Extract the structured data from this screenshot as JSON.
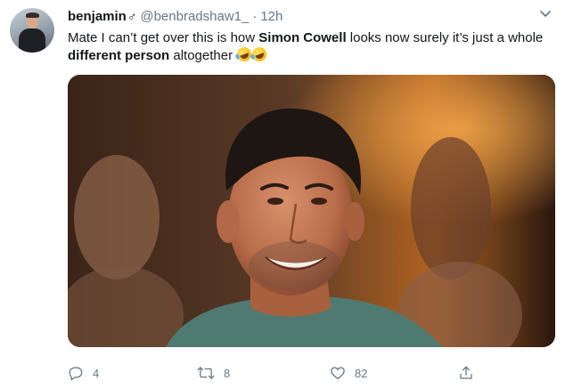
{
  "tweet": {
    "display_name": "benjamin",
    "name_symbol": "♂",
    "handle": "@benbradshaw1_",
    "separator": "·",
    "time": "12h",
    "text_parts": {
      "p1": "Mate I can’t get over this is how ",
      "bold1": "Simon Cowell",
      "p2": " looks now surely it’s just a whole ",
      "bold2": "different person",
      "p3": " altogether "
    },
    "emoji": "rolling-on-the-floor-laughing"
  },
  "actions": {
    "reply_count": "4",
    "retweet_count": "8",
    "like_count": "82"
  },
  "icons": {
    "reply": "reply-icon",
    "retweet": "retweet-icon",
    "like": "heart-icon",
    "share": "share-icon",
    "menu": "chevron-down-icon"
  },
  "colors": {
    "text": "#14171a",
    "secondary": "#657786",
    "background": "#ffffff"
  }
}
